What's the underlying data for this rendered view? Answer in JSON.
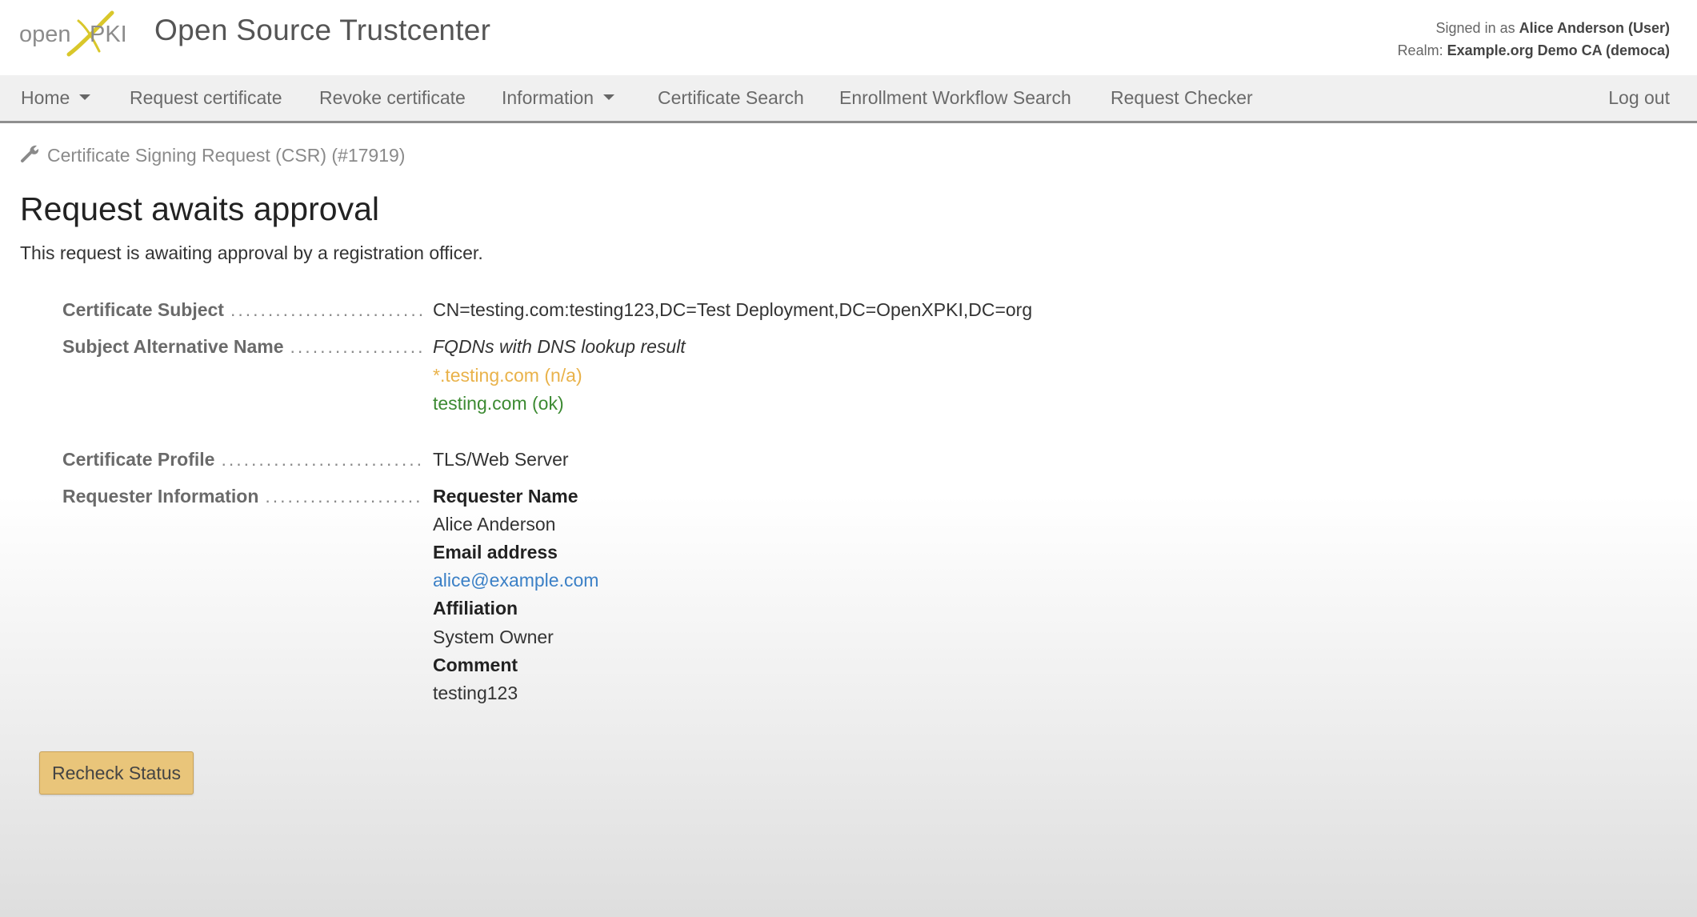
{
  "header": {
    "logo_text_left": "open",
    "logo_text_right": "PKI",
    "app_title": "Open Source Trustcenter",
    "signed_in_prefix": "Signed in as",
    "signed_in_user": "Alice Anderson (User)",
    "realm_prefix": "Realm:",
    "realm_name": "Example.org Demo CA (democa)"
  },
  "nav": {
    "home": "Home",
    "request_certificate": "Request certificate",
    "revoke_certificate": "Revoke certificate",
    "information": "Information",
    "certificate_search": "Certificate Search",
    "enrollment_workflow_search": "Enrollment Workflow Search",
    "request_checker": "Request Checker",
    "logout": "Log out"
  },
  "breadcrumb": "Certificate Signing Request (CSR) (#17919)",
  "page": {
    "heading": "Request awaits approval",
    "description": "This request is awaiting approval by a registration officer."
  },
  "details": {
    "subject_label": "Certificate Subject",
    "subject_value": "CN=testing.com:testing123,DC=Test Deployment,DC=OpenXPKI,DC=org",
    "san_label": "Subject Alternative Name",
    "san_header": "FQDNs with DNS lookup result",
    "san_entries": [
      "*.testing.com (n/a)",
      "testing.com (ok)"
    ],
    "profile_label": "Certificate Profile",
    "profile_value": "TLS/Web Server",
    "requester_label": "Requester Information",
    "requester_name_label": "Requester Name",
    "requester_name": "Alice Anderson",
    "email_label": "Email address",
    "email": "alice@example.com",
    "affiliation_label": "Affiliation",
    "affiliation": "System Owner",
    "comment_label": "Comment",
    "comment": "testing123"
  },
  "actions": {
    "recheck_status": "Recheck Status"
  },
  "colors": {
    "warn": "#e9b24a",
    "ok": "#3c8a32",
    "link": "#3b80c6",
    "button": "#e9c57a",
    "logo_yellow": "#d9c72a"
  }
}
